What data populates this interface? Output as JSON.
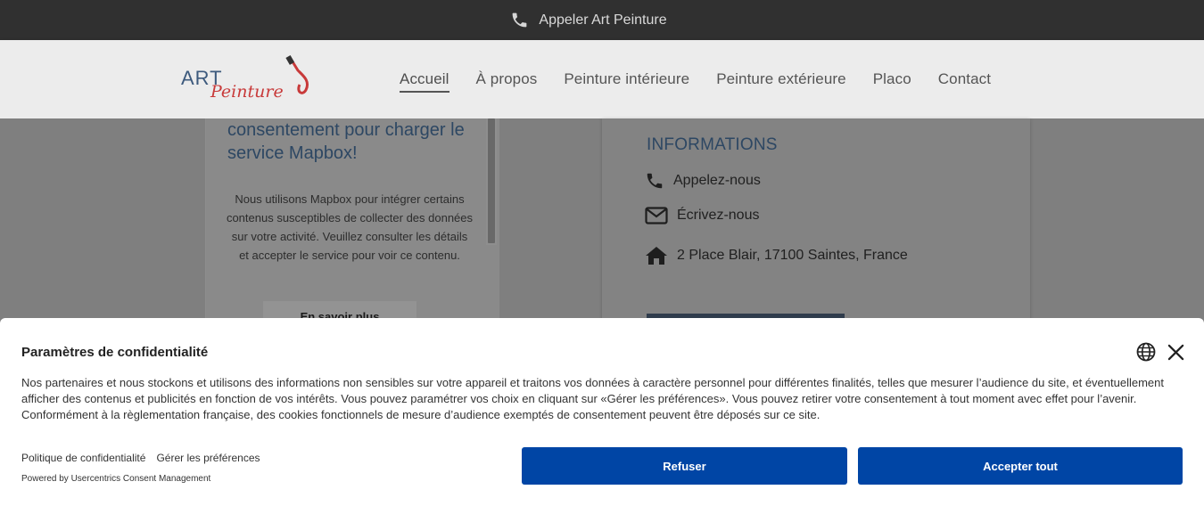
{
  "topbar": {
    "call_label": "Appeler Art Peinture",
    "icon": "phone-icon"
  },
  "header": {
    "logo": {
      "art": "ART",
      "peinture": "Peinture"
    },
    "nav": [
      {
        "label": "Accueil",
        "active": true
      },
      {
        "label": "À propos",
        "active": false
      },
      {
        "label": "Peinture intérieure",
        "active": false
      },
      {
        "label": "Peinture extérieure",
        "active": false
      },
      {
        "label": "Placo",
        "active": false
      },
      {
        "label": "Contact",
        "active": false
      }
    ]
  },
  "map_card": {
    "title": "consentement pour charger le service Mapbox!",
    "description": "Nous utilisons Mapbox pour intégrer certains contenus susceptibles de collecter des données sur votre activité. Veuillez consulter les détails et accepter le service pour voir ce contenu.",
    "more_label": "En savoir plus"
  },
  "info_card": {
    "heading": "INFORMATIONS",
    "phone_label": "Appelez-nous",
    "email_label": "Écrivez-nous",
    "address": "2 Place Blair, 17100 Saintes, France"
  },
  "consent": {
    "title": "Paramètres de confidentialité",
    "text": "Nos partenaires et nous stockons et utilisons des informations non sensibles sur votre appareil et traitons vos données à caractère personnel pour différentes finalités, telles que mesurer l’audience du site, et éventuellement afficher des contenus et publicités en fonction de vos intérêts. Vous pouvez paramétrer vos choix en cliquant sur «Gérer les préférences». Vous pouvez retirer votre consentement à tout moment avec effet pour l’avenir. Conformément à la règlementation française, des cookies fonctionnels de mesure d’audience exemptés de consentement peuvent être déposés sur ce site.",
    "privacy_link": "Politique de confidentialité",
    "prefs_link": "Gérer les préférences",
    "powered_by": "Powered by Usercentrics Consent Management",
    "refuse_label": "Refuser",
    "accept_label": "Accepter tout"
  },
  "colors": {
    "accent": "#0045a5",
    "topbar": "#303030",
    "heading_blue": "#2d4763",
    "logo_red": "#c83a3a",
    "logo_blue": "#3d5a7d"
  }
}
